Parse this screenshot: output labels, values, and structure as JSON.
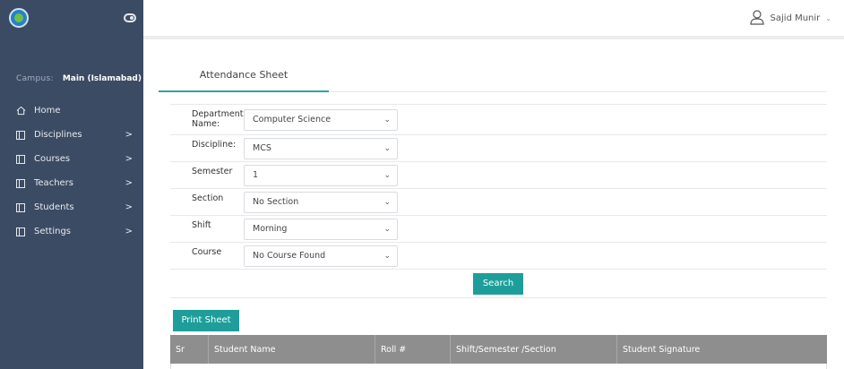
{
  "sidebar": {
    "campus_label": "Campus:",
    "campus_value": "Main (Islamabad)",
    "items": [
      {
        "label": "Home",
        "icon": "home-icon"
      },
      {
        "label": "Disciplines",
        "icon": "panel-icon",
        "chevron": ">"
      },
      {
        "label": "Courses",
        "icon": "panel-icon",
        "chevron": ">"
      },
      {
        "label": "Teachers",
        "icon": "panel-icon",
        "chevron": ">"
      },
      {
        "label": "Students",
        "icon": "panel-icon",
        "chevron": ">"
      },
      {
        "label": "Settings",
        "icon": "panel-icon",
        "chevron": ">"
      }
    ]
  },
  "header": {
    "user_name": "Sajid Munir",
    "user_caret": "⌄"
  },
  "tabs": [
    {
      "label": "Attendance Sheet",
      "active": true
    }
  ],
  "form": {
    "department": {
      "label": "Department Name:",
      "value": "Computer Science"
    },
    "discipline": {
      "label": "Discipline:",
      "value": "MCS"
    },
    "semester": {
      "label": "Semester",
      "value": "1"
    },
    "section": {
      "label": "Section",
      "value": "No Section"
    },
    "shift": {
      "label": "Shift",
      "value": "Morning"
    },
    "course": {
      "label": "Course",
      "value": "No Course Found"
    },
    "caret": "⌄"
  },
  "buttons": {
    "search": "Search",
    "print": "Print Sheet"
  },
  "table": {
    "columns": [
      "Sr",
      "Student Name",
      "Roll #",
      "Shift/Semester /Section",
      "Student Signature"
    ]
  },
  "colors": {
    "sidebar_bg": "#3c4b64",
    "accent": "#1e9e9a",
    "table_header_bg": "#8e8e8e"
  }
}
